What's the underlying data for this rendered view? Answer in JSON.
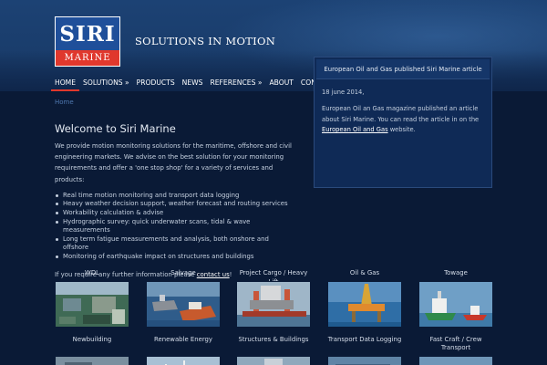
{
  "brand": {
    "logo_top": "SIRI",
    "logo_bottom": "MARINE",
    "tagline": "SOLUTIONS IN MOTION",
    "colors": {
      "logo_blue": "#1f4f9a",
      "logo_red": "#e0382d",
      "background": "#0a1a36"
    }
  },
  "nav": {
    "items": [
      {
        "label": "HOME",
        "active": true
      },
      {
        "label": "SOLUTIONS »",
        "active": false
      },
      {
        "label": "PRODUCTS",
        "active": false
      },
      {
        "label": "NEWS",
        "active": false
      },
      {
        "label": "REFERENCES »",
        "active": false
      },
      {
        "label": "ABOUT",
        "active": false
      },
      {
        "label": "CONTACT",
        "active": false
      }
    ]
  },
  "breadcrumb": "Home",
  "main": {
    "title": "Welcome to Siri Marine",
    "intro": "We provide motion monitoring solutions for the maritime, offshore and civil engineering markets. We advise on the best solution for your monitoring requirements and offer a 'one stop shop' for a variety of services and products:",
    "bullets": [
      "Real time motion monitoring and transport data logging",
      "Heavy weather decision support, weather forecast and routing services",
      "Workability calculation & advise",
      "Hydrographic survey:  quick underwater scans, tidal & wave measurements",
      "Long term fatigue measurements and analysis, both onshore and offshore",
      "Monitoring of earthquake impact on structures and buildings"
    ],
    "footer_text": "If you require any further information please ",
    "footer_link": "contact us",
    "footer_end": "!"
  },
  "news": {
    "heading": "European Oil and Gas published Siri Marine article",
    "date": "18 june 2014,",
    "body_before": "European Oil an Gas magazine published an article about Siri Marine. You can read the article in on the ",
    "link": "European Oil and Gas",
    "body_after": " website."
  },
  "gallery": {
    "row1": [
      {
        "label": "WDL",
        "icon": "deck-photo"
      },
      {
        "label": "Salvage",
        "icon": "salvage-ship-photo"
      },
      {
        "label": "Project Cargo / Heavy Lift",
        "icon": "heavy-lift-vessel-photo"
      },
      {
        "label": "Oil & Gas",
        "icon": "oil-rig-photo"
      },
      {
        "label": "Towage",
        "icon": "tug-boats-photo"
      }
    ],
    "row2": [
      {
        "label": "Newbuilding",
        "icon": "newbuilding-photo"
      },
      {
        "label": "Renewable Energy",
        "icon": "wind-turbine-photo"
      },
      {
        "label": "Structures & Buildings",
        "icon": "structures-photo"
      },
      {
        "label": "Transport Data Logging",
        "icon": "transport-photo"
      },
      {
        "label": "Fast Craft / Crew Transport",
        "icon": "fast-craft-photo"
      }
    ]
  }
}
